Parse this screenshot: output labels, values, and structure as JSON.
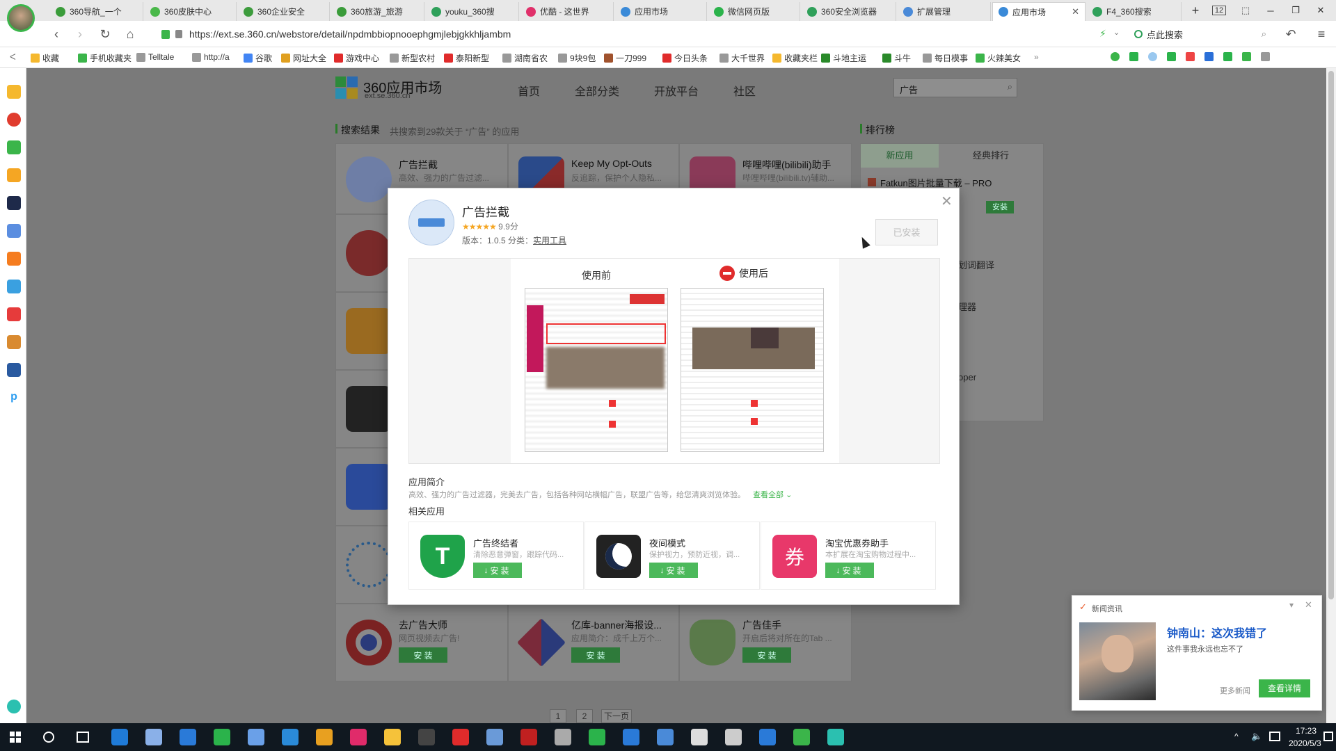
{
  "browser": {
    "tabs": [
      {
        "label": "360导航_一个",
        "color": "#3a9c3a"
      },
      {
        "label": "360皮肤中心",
        "color": "#4ab84a"
      },
      {
        "label": "360企业安全",
        "color": "#3d9c3d"
      },
      {
        "label": "360旅游_旅游",
        "color": "#3a9c3a"
      },
      {
        "label": "youku_360搜",
        "color": "#2fa05a"
      },
      {
        "label": "优酷 - 这世界",
        "color": "#e0306a"
      },
      {
        "label": "应用市场",
        "color": "#3a8ad8"
      },
      {
        "label": "微信网页版",
        "color": "#2bb34b"
      },
      {
        "label": "360安全浏览器",
        "color": "#2fa05a"
      },
      {
        "label": "扩展管理",
        "color": "#4a8ad8"
      },
      {
        "label": "应用市场",
        "color": "#3a8ad8"
      },
      {
        "label": "F4_360搜索",
        "color": "#2fa05a"
      }
    ],
    "tab_count": "12",
    "url": "https://ext.se.360.cn/webstore/detail/npdmbbiopnooephgmjlebjgkkhljambm",
    "url_host": "ext.se.360.cn",
    "search_placeholder": "点此搜索",
    "bookmarks": [
      "收藏",
      "手机收藏夹",
      "Telltale",
      "http://a",
      "谷歌",
      "网址大全",
      "游戏中心",
      "新型农村",
      "泰阳新型",
      "湖南省农",
      "9块9包",
      "一刀999",
      "今日头条",
      "大千世界",
      "收藏夹栏",
      "斗地主运",
      "斗牛",
      "每日模事",
      "火辣美女"
    ]
  },
  "site": {
    "logo_title": "360应用市场",
    "logo_sub": "ext.se.360.cn",
    "nav": [
      "首页",
      "全部分类",
      "开放平台",
      "社区"
    ],
    "search_value": "广告",
    "results_title": "搜索结果",
    "results_summary": "共搜索到29款关于 “广告” 的应用",
    "ranking_title": "排行榜",
    "rank_tabs": [
      "新应用",
      "经典排行"
    ],
    "rank_items": [
      "Fatkun图片批量下载 – PRO",
      "划词翻译",
      "理器",
      "oper"
    ],
    "rank_install": "安装",
    "cards_top": [
      {
        "name": "广告拦截",
        "desc": "高效、强力的广告过滤..."
      },
      {
        "name": "Keep My Opt-Outs",
        "desc": "反追踪，保护个人隐私..."
      },
      {
        "name": "哔哩哔哩(bilibili)助手",
        "desc": "哔哩哔哩(bilibili.tv)辅助..."
      }
    ],
    "cards_bottom": [
      {
        "name": "去广告大师",
        "desc": "网页视频去广告!",
        "btn": "安 装"
      },
      {
        "name": "亿库-banner海报设...",
        "desc": "应用简介：成千上万个...",
        "btn": "安 装"
      },
      {
        "name": "广告佳手",
        "desc": "开启后将对所在的Tab ...",
        "btn": "安 装"
      }
    ],
    "pagination": [
      "1",
      "2",
      "下一页"
    ]
  },
  "modal": {
    "app_name": "广告拦截",
    "rating": "9.9分",
    "version_label": "版本：1.0.5 分类：",
    "category": "实用工具",
    "installed_label": "已安装",
    "before_label": "使用前",
    "after_label": "使用后",
    "intro_title": "应用简介",
    "intro_text": "高效、强力的广告过滤器，完美去广告，包括各种网站横幅广告，联盟广告等，给您清爽浏览体验。",
    "view_all": "查看全部",
    "related_title": "相关应用",
    "related": [
      {
        "name": "广告终结者",
        "desc": "清除恶意弹窗，跟踪代码...",
        "btn": "安装"
      },
      {
        "name": "夜间模式",
        "desc": "保护视力，预防近视，调...",
        "btn": "安装"
      },
      {
        "name": "淘宝优惠券助手",
        "desc": "本扩展在淘宝购物过程中...",
        "btn": "安装"
      }
    ]
  },
  "news": {
    "header": "新闻资讯",
    "headline": "钟南山：这次我错了",
    "sub": "这件事我永远也忘不了",
    "more": "更多新闻",
    "detail": "查看详情"
  },
  "taskbar": {
    "time": "17:23",
    "date": "2020/5/3"
  }
}
